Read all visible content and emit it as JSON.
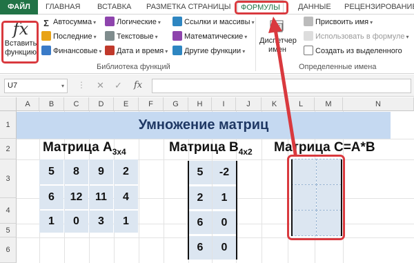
{
  "menu": {
    "tabs": [
      "ФАЙЛ",
      "ГЛАВНАЯ",
      "ВСТАВКА",
      "РАЗМЕТКА СТРАНИЦЫ",
      "ФОРМУЛЫ",
      "ДАННЫЕ",
      "РЕЦЕНЗИРОВАНИЕ"
    ],
    "active": "ФОРМУЛЫ"
  },
  "ribbon": {
    "insert_function": {
      "icon": "fx",
      "label1": "Вставить",
      "label2": "функцию"
    },
    "library": {
      "col1": [
        "Автосумма",
        "Последние",
        "Финансовые"
      ],
      "col2": [
        "Логические",
        "Текстовые",
        "Дата и время"
      ],
      "col3": [
        "Ссылки и массивы",
        "Математические",
        "Другие функции"
      ],
      "label": "Библиотека функций"
    },
    "dispatcher": {
      "label1": "Диспетчер",
      "label2": "имен"
    },
    "names": {
      "items": [
        "Присвоить имя",
        "Использовать в формуле",
        "Создать из выделенного"
      ],
      "label": "Определенные имена"
    }
  },
  "formula_bar": {
    "cell": "U7",
    "fx": "fx",
    "cancel": "✕",
    "enter": "✓"
  },
  "grid": {
    "columns": [
      "A",
      "B",
      "C",
      "D",
      "E",
      "F",
      "G",
      "H",
      "I",
      "J",
      "K",
      "L",
      "M",
      "N"
    ],
    "rows": [
      "1",
      "2",
      "3",
      "4",
      "5",
      "6"
    ]
  },
  "sheet": {
    "title": "Умножение матриц",
    "matrix_a": {
      "label": "Матрица A",
      "sub": "3x4",
      "rows": [
        [
          "5",
          "8",
          "9",
          "2"
        ],
        [
          "6",
          "12",
          "11",
          "4"
        ],
        [
          "1",
          "0",
          "3",
          "1"
        ]
      ]
    },
    "matrix_b": {
      "label": "Матрица B",
      "sub": "4x2",
      "rows": [
        [
          "5",
          "-2"
        ],
        [
          "2",
          "1"
        ],
        [
          "6",
          "0"
        ],
        [
          "6",
          "0"
        ]
      ]
    },
    "matrix_c": {
      "label": "Матрица C=A*B"
    }
  },
  "colors": {
    "accent": "#217346",
    "callout": "#d9393e",
    "title_band": "#c5d9f1",
    "matrix_fill": "#dce6f1"
  }
}
